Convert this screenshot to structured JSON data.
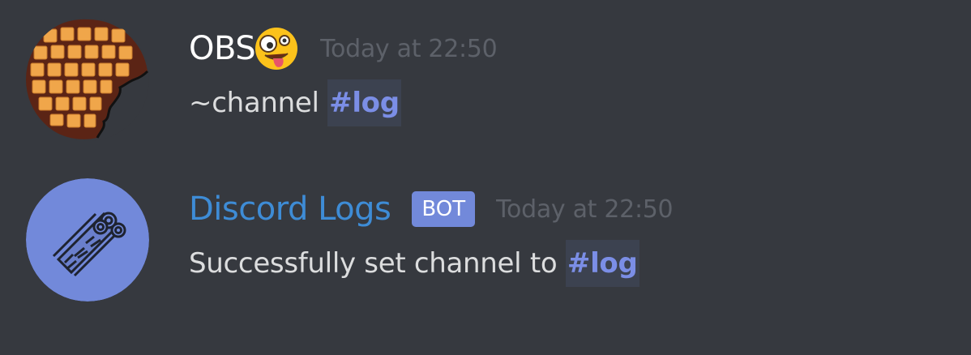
{
  "messages": [
    {
      "author": "OBS",
      "author_emoji": "zany-face-emoji",
      "timestamp": "Today at 22:50",
      "content_prefix": "~channel ",
      "channel_mention": "#log",
      "avatar_icon": "waffle-avatar"
    },
    {
      "author": "Discord Logs",
      "tag": "BOT",
      "timestamp": "Today at 22:50",
      "content_prefix": "Successfully set channel to ",
      "channel_mention": "#log",
      "avatar_icon": "logs-avatar"
    }
  ],
  "colors": {
    "background": "#36393f",
    "bot_name": "#3e8cd6",
    "bot_tag": "#7289da",
    "mention_text": "#7b8ee6",
    "mention_bg": "#3c4250",
    "timestamp": "#5d6169",
    "message_text": "#dcddde"
  }
}
